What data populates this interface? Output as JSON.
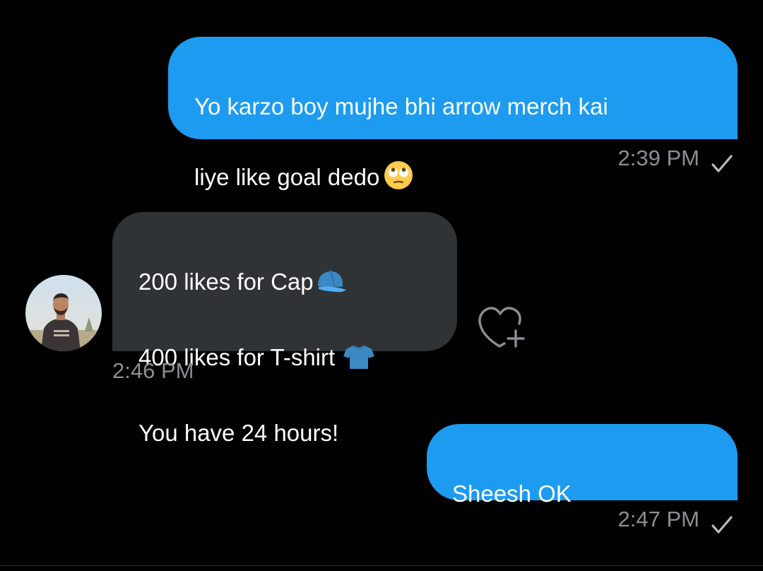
{
  "colors": {
    "background": "#000000",
    "outgoing_bubble": "#1d9bf0",
    "incoming_bubble": "#2f3336",
    "timestamp": "#8b8f93"
  },
  "messages": [
    {
      "direction": "outgoing",
      "line1": "Yo karzo boy mujhe bhi arrow merch kai",
      "line2": "liye like goal dedo",
      "emoji": "face-with-rolling-eyes-icon",
      "time": "2:39 PM",
      "status_icon": "check-icon"
    },
    {
      "direction": "incoming",
      "line1": "200 likes for Cap",
      "line1_emoji": "cap-icon",
      "line2": "400 likes for T-shirt",
      "line2_emoji": "t-shirt-icon",
      "line3": "You have 24 hours!",
      "time": "2:46 PM",
      "avatar_icon": "avatar",
      "reaction_icon": "heart-plus-icon"
    },
    {
      "direction": "outgoing",
      "line1": "Sheesh OK",
      "time": "2:47 PM",
      "status_icon": "check-icon"
    }
  ]
}
